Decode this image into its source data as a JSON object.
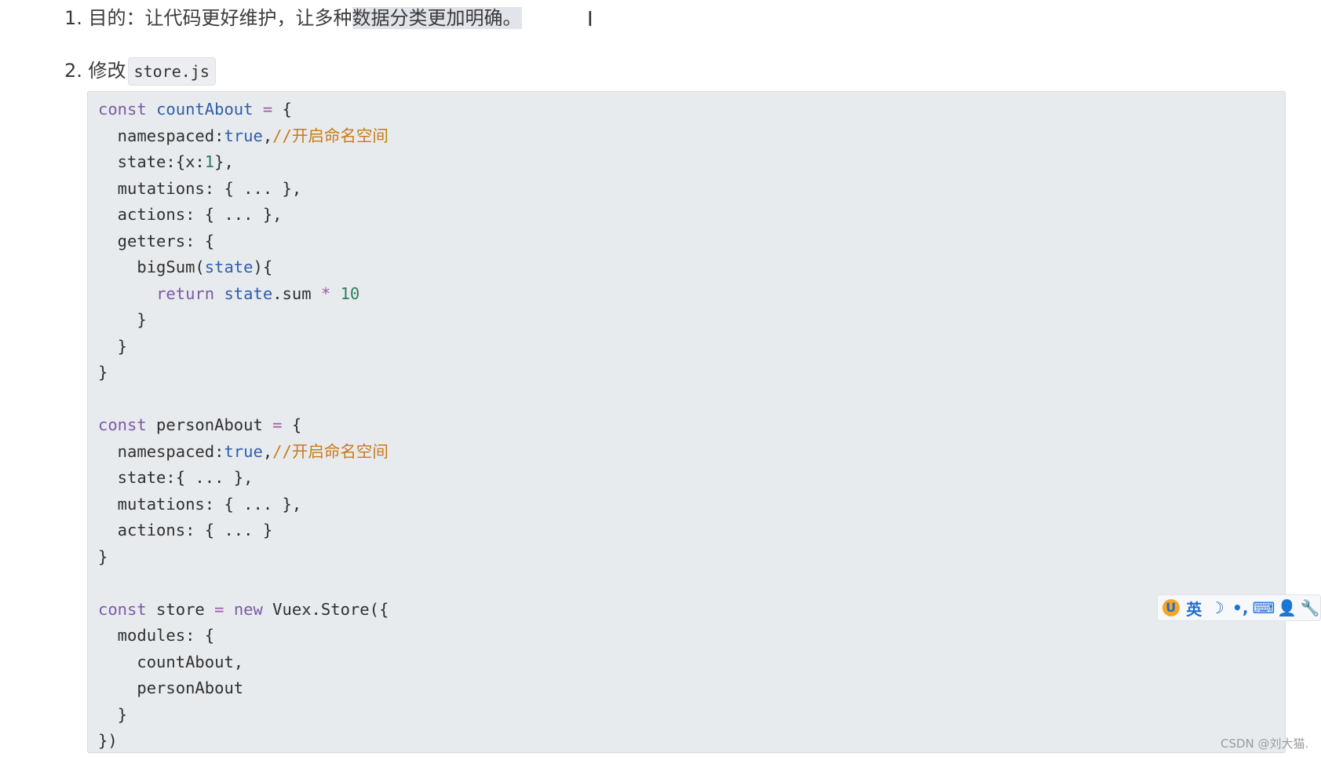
{
  "list": {
    "item1": {
      "number": "1.",
      "text_plain": "目的：让代码更好维护，让多种",
      "text_highlighted": "数据分类更加明确。"
    },
    "item2": {
      "number": "2.",
      "text": "修改",
      "filename": "store.js"
    }
  },
  "code": {
    "lines": [
      [
        {
          "t": "const",
          "c": "kw"
        },
        {
          "t": " "
        },
        {
          "t": "countAbout",
          "c": "def"
        },
        {
          "t": " "
        },
        {
          "t": "=",
          "c": "op"
        },
        {
          "t": " {"
        }
      ],
      [
        {
          "t": "  namespaced:"
        },
        {
          "t": "true",
          "c": "atom"
        },
        {
          "t": ","
        },
        {
          "t": "//开启命名空间",
          "c": "cm"
        }
      ],
      [
        {
          "t": "  state:{x:"
        },
        {
          "t": "1",
          "c": "num"
        },
        {
          "t": "},"
        }
      ],
      [
        {
          "t": "  mutations: { ... },"
        }
      ],
      [
        {
          "t": "  actions: { ... },"
        }
      ],
      [
        {
          "t": "  getters: {"
        }
      ],
      [
        {
          "t": "    bigSum("
        },
        {
          "t": "state",
          "c": "def"
        },
        {
          "t": "){"
        }
      ],
      [
        {
          "t": "      "
        },
        {
          "t": "return",
          "c": "kw"
        },
        {
          "t": " "
        },
        {
          "t": "state",
          "c": "def"
        },
        {
          "t": ".sum "
        },
        {
          "t": "*",
          "c": "op"
        },
        {
          "t": " "
        },
        {
          "t": "10",
          "c": "num"
        }
      ],
      [
        {
          "t": "    }"
        }
      ],
      [
        {
          "t": "  }"
        }
      ],
      [
        {
          "t": "}"
        }
      ],
      [
        {
          "t": ""
        }
      ],
      [
        {
          "t": "const",
          "c": "kw"
        },
        {
          "t": " personAbout "
        },
        {
          "t": "=",
          "c": "op"
        },
        {
          "t": " {"
        }
      ],
      [
        {
          "t": "  namespaced:"
        },
        {
          "t": "true",
          "c": "atom"
        },
        {
          "t": ","
        },
        {
          "t": "//开启命名空间",
          "c": "cm"
        }
      ],
      [
        {
          "t": "  state:{ ... },"
        }
      ],
      [
        {
          "t": "  mutations: { ... },"
        }
      ],
      [
        {
          "t": "  actions: { ... }"
        }
      ],
      [
        {
          "t": "}"
        }
      ],
      [
        {
          "t": ""
        }
      ],
      [
        {
          "t": "const",
          "c": "kw"
        },
        {
          "t": " store "
        },
        {
          "t": "=",
          "c": "op"
        },
        {
          "t": " "
        },
        {
          "t": "new",
          "c": "kw"
        },
        {
          "t": " Vuex.Store({"
        }
      ],
      [
        {
          "t": "  modules: {"
        }
      ],
      [
        {
          "t": "    countAbout,"
        }
      ],
      [
        {
          "t": "    personAbout"
        }
      ],
      [
        {
          "t": "  }"
        }
      ],
      [
        {
          "t": "})"
        }
      ]
    ]
  },
  "ime_toolbar": {
    "logo": "U",
    "language": "英",
    "moon": "☽",
    "punct": "•,",
    "keyboard": "⌨",
    "user": "👤",
    "wrench": "🔧",
    "icons": [
      "sogou-logo-icon",
      "language-toggle",
      "moon-icon",
      "punctuation-icon",
      "keyboard-icon",
      "user-icon",
      "wrench-icon"
    ]
  },
  "cursor": {
    "glyph": "I"
  },
  "watermark": "CSDN @刘大猫.",
  "colors": {
    "keyword": "#7a5aa6",
    "definition": "#2f5fa8",
    "number": "#2a7f5e",
    "comment": "#c87a1a",
    "code_bg": "#e8ebee",
    "highlight": "#e1e4ea"
  }
}
